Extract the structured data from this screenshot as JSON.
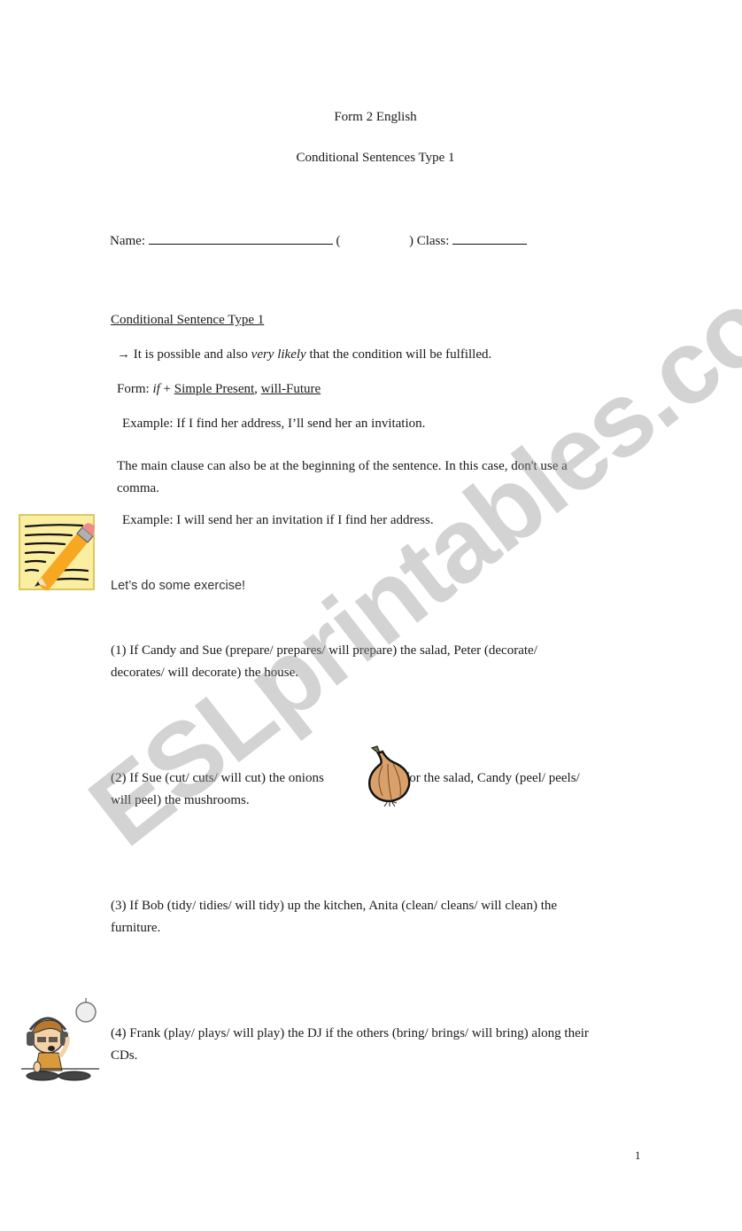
{
  "header": {
    "course": "Form 2 English",
    "title": "Conditional Sentences Type 1"
  },
  "student_fields": {
    "name_label": "Name:",
    "open_paren": "(",
    "close_paren_class_label": ") Class:"
  },
  "lesson": {
    "heading": "Conditional Sentence Type 1",
    "arrow": "→",
    "note_pre": "It is possible and also ",
    "note_italic": "very likely",
    "note_post": " that the condition will be fulfilled.",
    "form_label": "Form: ",
    "form_if": "if",
    "form_plus": " + ",
    "form_part1": "Simple Present",
    "form_comma": ", ",
    "form_part2": "will-Future",
    "example1": "Example: If I find her address, I’ll send her an invitation.",
    "main_clause_line1": "The main clause can also be at the beginning of the sentence. In this case, don't use a",
    "main_clause_line2": "comma.",
    "example2": "Example: I will send her an invitation if I find her address."
  },
  "exercise": {
    "intro": "Let’s do some exercise!",
    "items": [
      {
        "line1": "(1) If Candy and Sue (prepare/ prepares/ will prepare) the salad, Peter (decorate/",
        "line2": "decorates/ will decorate) the house."
      },
      {
        "line1a": "(2) If Sue (cut/ cuts/ will cut) the onions",
        "line1b": "for the salad, Candy (peel/ peels/",
        "line2": "will peel) the mushrooms."
      },
      {
        "line1": "(3) If Bob (tidy/ tidies/ will tidy) up the kitchen, Anita (clean/ cleans/ will clean) the",
        "line2": "furniture."
      },
      {
        "line1": "(4) Frank (play/ plays/ will play) the DJ if the others (bring/ brings/ will bring) along their",
        "line2": "CDs."
      }
    ]
  },
  "page_number": "1",
  "watermark": "ESLprintables.com",
  "icons": {
    "notepad": "notepad-pencil-icon",
    "onion": "onion-icon",
    "dj": "dj-boy-icon"
  }
}
